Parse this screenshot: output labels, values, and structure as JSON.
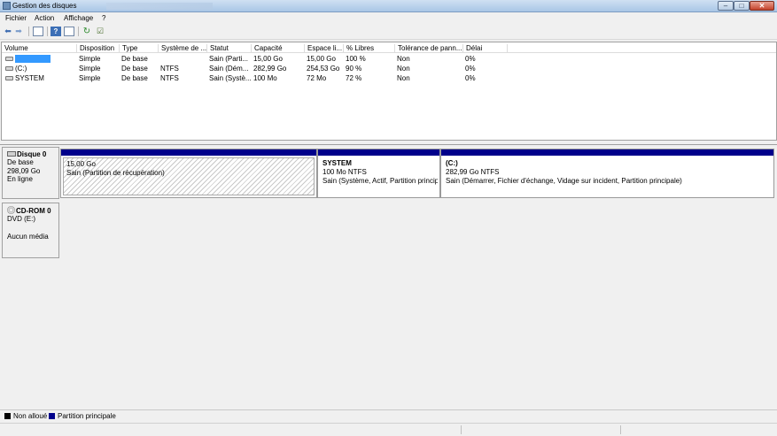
{
  "window": {
    "title": "Gestion des disques"
  },
  "titlebar_buttons": {
    "minimize": "–",
    "maximize": "□",
    "close": "✕"
  },
  "menu": [
    "Fichier",
    "Action",
    "Affichage",
    "?"
  ],
  "volume_table": {
    "headers": [
      "Volume",
      "Disposition",
      "Type",
      "Système de ...",
      "Statut",
      "Capacité",
      "Espace li...",
      "% Libres",
      "Tolérance de pann...",
      "Délai"
    ],
    "rows": [
      {
        "volume": "",
        "disposition": "Simple",
        "type": "De base",
        "fs": "",
        "status": "Sain (Parti...",
        "capacity": "15,00 Go",
        "free": "15,00 Go",
        "pct": "100 %",
        "fault": "Non",
        "delay": "0%"
      },
      {
        "volume": "(C:)",
        "disposition": "Simple",
        "type": "De base",
        "fs": "NTFS",
        "status": "Sain (Dém...",
        "capacity": "282,99 Go",
        "free": "254,53 Go",
        "pct": "90 %",
        "fault": "Non",
        "delay": "0%"
      },
      {
        "volume": "SYSTEM",
        "disposition": "Simple",
        "type": "De base",
        "fs": "NTFS",
        "status": "Sain (Systè...",
        "capacity": "100 Mo",
        "free": "72 Mo",
        "pct": "72 %",
        "fault": "Non",
        "delay": "0%"
      }
    ]
  },
  "disk0": {
    "name": "Disque 0",
    "type": "De base",
    "size": "298,09 Go",
    "status": "En ligne",
    "partitions": [
      {
        "title": "",
        "size": "15,00 Go",
        "desc": "Sain (Partition de récupération)"
      },
      {
        "title": "SYSTEM",
        "size": "100 Mo NTFS",
        "desc": "Sain (Système, Actif, Partition principa"
      },
      {
        "title": "(C:)",
        "size": "282,99 Go NTFS",
        "desc": "Sain (Démarrer, Fichier d'échange, Vidage sur incident, Partition principale)"
      }
    ]
  },
  "cdrom0": {
    "name": "CD-ROM 0",
    "drive": "DVD (E:)",
    "media": "Aucun média"
  },
  "legend": {
    "unallocated": "Non alloué",
    "primary": "Partition principale",
    "colors": {
      "unallocated": "#000000",
      "primary": "#00008b"
    }
  }
}
